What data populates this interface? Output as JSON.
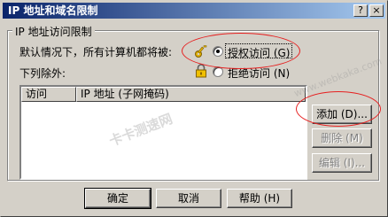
{
  "window": {
    "title": "IP 地址和域名限制",
    "help_glyph": "?",
    "close_glyph": "×"
  },
  "group": {
    "legend": "IP 地址访问限制",
    "default_label": "默认情况下，所有计算机都将被:",
    "exceptions_label": "下列除外:",
    "radio_grant": "授权访问 (G)",
    "radio_deny": "拒绝访问 (N)",
    "radio_grant_selected": true
  },
  "list": {
    "columns": [
      "访问",
      "IP 地址 (子网掩码)"
    ],
    "rows": []
  },
  "buttons": {
    "add": "添加 (D)...",
    "remove": "删除 (M)",
    "edit": "编辑 (I)...",
    "ok": "确定",
    "cancel": "取消",
    "help": "帮助 (H)"
  },
  "watermark": {
    "site": "www.webkaka.com",
    "brand": "卡卡测速网"
  },
  "icons": {
    "grant": "key-icon",
    "deny": "lock-icon"
  },
  "colors": {
    "dialog_bg": "#d4d0c8",
    "title_start": "#0a246a",
    "title_end": "#a6caf0",
    "annotation": "#e62020"
  }
}
